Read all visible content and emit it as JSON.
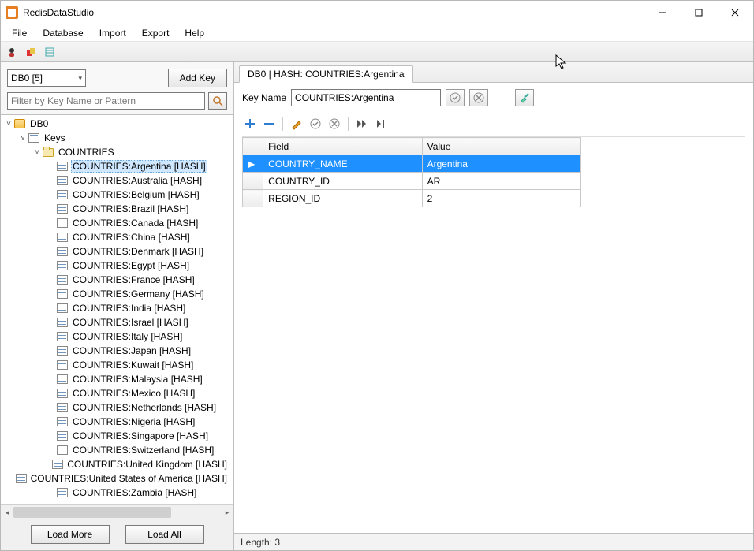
{
  "app": {
    "title": "RedisDataStudio"
  },
  "menu": {
    "items": [
      "File",
      "Database",
      "Import",
      "Export",
      "Help"
    ]
  },
  "toolbar_icons": [
    "icon-1",
    "icon-2",
    "icon-3"
  ],
  "sidebar": {
    "db_selector": "DB0 [5]",
    "add_key_label": "Add Key",
    "filter_placeholder": "Filter by Key Name or Pattern",
    "load_more_label": "Load More",
    "load_all_label": "Load All",
    "root": {
      "label": "DB0"
    },
    "keys_node": {
      "label": "Keys"
    },
    "folder": {
      "label": "COUNTRIES"
    },
    "items": [
      {
        "label": "COUNTRIES:Argentina [HASH]",
        "selected": true
      },
      {
        "label": "COUNTRIES:Australia [HASH]"
      },
      {
        "label": "COUNTRIES:Belgium [HASH]"
      },
      {
        "label": "COUNTRIES:Brazil [HASH]"
      },
      {
        "label": "COUNTRIES:Canada [HASH]"
      },
      {
        "label": "COUNTRIES:China [HASH]"
      },
      {
        "label": "COUNTRIES:Denmark [HASH]"
      },
      {
        "label": "COUNTRIES:Egypt [HASH]"
      },
      {
        "label": "COUNTRIES:France [HASH]"
      },
      {
        "label": "COUNTRIES:Germany [HASH]"
      },
      {
        "label": "COUNTRIES:India [HASH]"
      },
      {
        "label": "COUNTRIES:Israel [HASH]"
      },
      {
        "label": "COUNTRIES:Italy [HASH]"
      },
      {
        "label": "COUNTRIES:Japan [HASH]"
      },
      {
        "label": "COUNTRIES:Kuwait [HASH]"
      },
      {
        "label": "COUNTRIES:Malaysia [HASH]"
      },
      {
        "label": "COUNTRIES:Mexico [HASH]"
      },
      {
        "label": "COUNTRIES:Netherlands [HASH]"
      },
      {
        "label": "COUNTRIES:Nigeria [HASH]"
      },
      {
        "label": "COUNTRIES:Singapore [HASH]"
      },
      {
        "label": "COUNTRIES:Switzerland [HASH]"
      },
      {
        "label": "COUNTRIES:United Kingdom [HASH]"
      },
      {
        "label": "COUNTRIES:United States of America [HASH]"
      },
      {
        "label": "COUNTRIES:Zambia [HASH]"
      }
    ]
  },
  "detail": {
    "tab_label": "DB0 | HASH: COUNTRIES:Argentina",
    "key_name_label": "Key Name",
    "key_name_value": "COUNTRIES:Argentina",
    "columns": [
      "Field",
      "Value"
    ],
    "rows": [
      {
        "field": "COUNTRY_NAME",
        "value": "Argentina",
        "selected": true
      },
      {
        "field": "COUNTRY_ID",
        "value": "AR"
      },
      {
        "field": "REGION_ID",
        "value": "2"
      }
    ],
    "status": "Length: 3"
  }
}
